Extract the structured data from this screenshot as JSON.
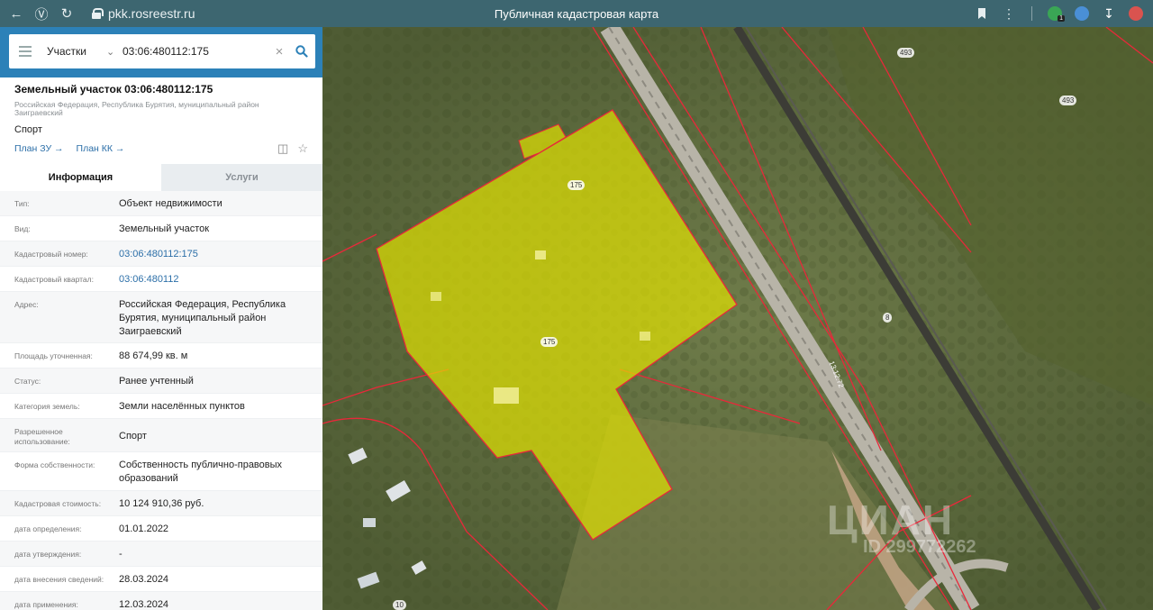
{
  "browser": {
    "url": "pkk.rosreestr.ru",
    "title": "Публичная кадастровая карта",
    "extension_badge": "1"
  },
  "search": {
    "type_label": "Участки",
    "query": "03:06:480112:175"
  },
  "parcel": {
    "title": "Земельный участок 03:06:480112:175",
    "address": "Российская Федерация, Республика Бурятия, муниципальный район Заиграевский",
    "use": "Спорт",
    "plan_zu": "План ЗУ →",
    "plan_kk": "План КК →"
  },
  "tabs": {
    "info": "Информация",
    "services": "Услуги"
  },
  "rows": [
    {
      "label": "Тип:",
      "value": "Объект недвижимости"
    },
    {
      "label": "Вид:",
      "value": "Земельный участок"
    },
    {
      "label": "Кадастровый номер:",
      "value": "03:06:480112:175"
    },
    {
      "label": "Кадастровый квартал:",
      "value": "03:06:480112"
    },
    {
      "label": "Адрес:",
      "value": "Российская Федерация, Республика Бурятия, муниципальный район Заиграевский"
    },
    {
      "label": "Площадь уточненная:",
      "value": "88 674,99 кв. м"
    },
    {
      "label": "Статус:",
      "value": "Ранее учтенный"
    },
    {
      "label": "Категория земель:",
      "value": "Земли населённых пунктов"
    },
    {
      "label": "Разрешенное использование:",
      "value": "Спорт"
    },
    {
      "label": "Форма собственности:",
      "value": "Собственность публично-правовых образований"
    },
    {
      "label": "Кадастровая стоимость:",
      "value": "10 124 910,36 руб."
    },
    {
      "label": "дата определения:",
      "value": "01.01.2022"
    },
    {
      "label": "дата утверждения:",
      "value": "-"
    },
    {
      "label": "дата внесения сведений:",
      "value": "28.03.2024"
    },
    {
      "label": "дата применения:",
      "value": "12.03.2024"
    }
  ],
  "map": {
    "labels": {
      "parcel_a": "175",
      "parcel_b": "175",
      "road_code": "13:12:72",
      "n493a": "493",
      "n493b": "493",
      "n8": "8",
      "n10": "10"
    },
    "watermark": {
      "brand": "ЦИАН",
      "id": "ID 299772262"
    },
    "colors": {
      "parcel_fill": "#e6e600",
      "boundary": "#e8283a"
    }
  }
}
